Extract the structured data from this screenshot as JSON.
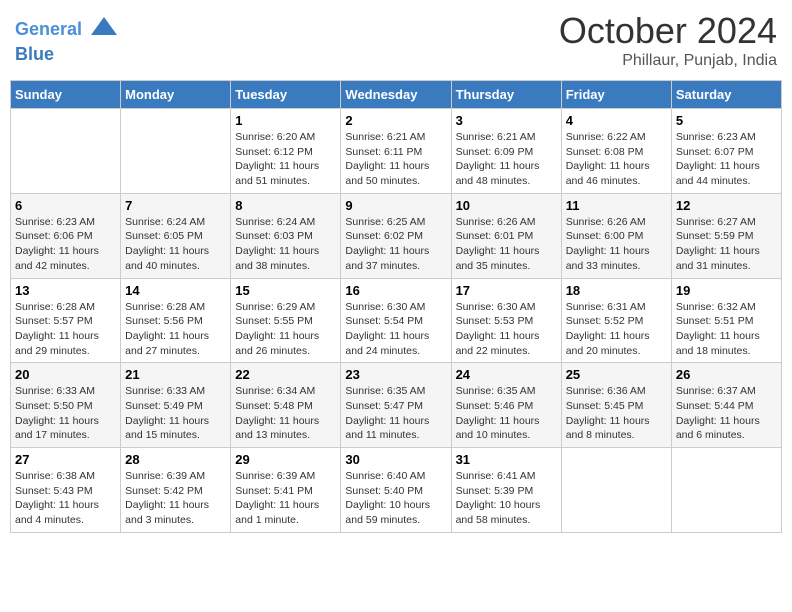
{
  "header": {
    "logo_line1": "General",
    "logo_line2": "Blue",
    "month": "October 2024",
    "location": "Phillaur, Punjab, India"
  },
  "weekdays": [
    "Sunday",
    "Monday",
    "Tuesday",
    "Wednesday",
    "Thursday",
    "Friday",
    "Saturday"
  ],
  "weeks": [
    [
      {
        "day": "",
        "info": ""
      },
      {
        "day": "",
        "info": ""
      },
      {
        "day": "1",
        "info": "Sunrise: 6:20 AM\nSunset: 6:12 PM\nDaylight: 11 hours and 51 minutes."
      },
      {
        "day": "2",
        "info": "Sunrise: 6:21 AM\nSunset: 6:11 PM\nDaylight: 11 hours and 50 minutes."
      },
      {
        "day": "3",
        "info": "Sunrise: 6:21 AM\nSunset: 6:09 PM\nDaylight: 11 hours and 48 minutes."
      },
      {
        "day": "4",
        "info": "Sunrise: 6:22 AM\nSunset: 6:08 PM\nDaylight: 11 hours and 46 minutes."
      },
      {
        "day": "5",
        "info": "Sunrise: 6:23 AM\nSunset: 6:07 PM\nDaylight: 11 hours and 44 minutes."
      }
    ],
    [
      {
        "day": "6",
        "info": "Sunrise: 6:23 AM\nSunset: 6:06 PM\nDaylight: 11 hours and 42 minutes."
      },
      {
        "day": "7",
        "info": "Sunrise: 6:24 AM\nSunset: 6:05 PM\nDaylight: 11 hours and 40 minutes."
      },
      {
        "day": "8",
        "info": "Sunrise: 6:24 AM\nSunset: 6:03 PM\nDaylight: 11 hours and 38 minutes."
      },
      {
        "day": "9",
        "info": "Sunrise: 6:25 AM\nSunset: 6:02 PM\nDaylight: 11 hours and 37 minutes."
      },
      {
        "day": "10",
        "info": "Sunrise: 6:26 AM\nSunset: 6:01 PM\nDaylight: 11 hours and 35 minutes."
      },
      {
        "day": "11",
        "info": "Sunrise: 6:26 AM\nSunset: 6:00 PM\nDaylight: 11 hours and 33 minutes."
      },
      {
        "day": "12",
        "info": "Sunrise: 6:27 AM\nSunset: 5:59 PM\nDaylight: 11 hours and 31 minutes."
      }
    ],
    [
      {
        "day": "13",
        "info": "Sunrise: 6:28 AM\nSunset: 5:57 PM\nDaylight: 11 hours and 29 minutes."
      },
      {
        "day": "14",
        "info": "Sunrise: 6:28 AM\nSunset: 5:56 PM\nDaylight: 11 hours and 27 minutes."
      },
      {
        "day": "15",
        "info": "Sunrise: 6:29 AM\nSunset: 5:55 PM\nDaylight: 11 hours and 26 minutes."
      },
      {
        "day": "16",
        "info": "Sunrise: 6:30 AM\nSunset: 5:54 PM\nDaylight: 11 hours and 24 minutes."
      },
      {
        "day": "17",
        "info": "Sunrise: 6:30 AM\nSunset: 5:53 PM\nDaylight: 11 hours and 22 minutes."
      },
      {
        "day": "18",
        "info": "Sunrise: 6:31 AM\nSunset: 5:52 PM\nDaylight: 11 hours and 20 minutes."
      },
      {
        "day": "19",
        "info": "Sunrise: 6:32 AM\nSunset: 5:51 PM\nDaylight: 11 hours and 18 minutes."
      }
    ],
    [
      {
        "day": "20",
        "info": "Sunrise: 6:33 AM\nSunset: 5:50 PM\nDaylight: 11 hours and 17 minutes."
      },
      {
        "day": "21",
        "info": "Sunrise: 6:33 AM\nSunset: 5:49 PM\nDaylight: 11 hours and 15 minutes."
      },
      {
        "day": "22",
        "info": "Sunrise: 6:34 AM\nSunset: 5:48 PM\nDaylight: 11 hours and 13 minutes."
      },
      {
        "day": "23",
        "info": "Sunrise: 6:35 AM\nSunset: 5:47 PM\nDaylight: 11 hours and 11 minutes."
      },
      {
        "day": "24",
        "info": "Sunrise: 6:35 AM\nSunset: 5:46 PM\nDaylight: 11 hours and 10 minutes."
      },
      {
        "day": "25",
        "info": "Sunrise: 6:36 AM\nSunset: 5:45 PM\nDaylight: 11 hours and 8 minutes."
      },
      {
        "day": "26",
        "info": "Sunrise: 6:37 AM\nSunset: 5:44 PM\nDaylight: 11 hours and 6 minutes."
      }
    ],
    [
      {
        "day": "27",
        "info": "Sunrise: 6:38 AM\nSunset: 5:43 PM\nDaylight: 11 hours and 4 minutes."
      },
      {
        "day": "28",
        "info": "Sunrise: 6:39 AM\nSunset: 5:42 PM\nDaylight: 11 hours and 3 minutes."
      },
      {
        "day": "29",
        "info": "Sunrise: 6:39 AM\nSunset: 5:41 PM\nDaylight: 11 hours and 1 minute."
      },
      {
        "day": "30",
        "info": "Sunrise: 6:40 AM\nSunset: 5:40 PM\nDaylight: 10 hours and 59 minutes."
      },
      {
        "day": "31",
        "info": "Sunrise: 6:41 AM\nSunset: 5:39 PM\nDaylight: 10 hours and 58 minutes."
      },
      {
        "day": "",
        "info": ""
      },
      {
        "day": "",
        "info": ""
      }
    ]
  ]
}
